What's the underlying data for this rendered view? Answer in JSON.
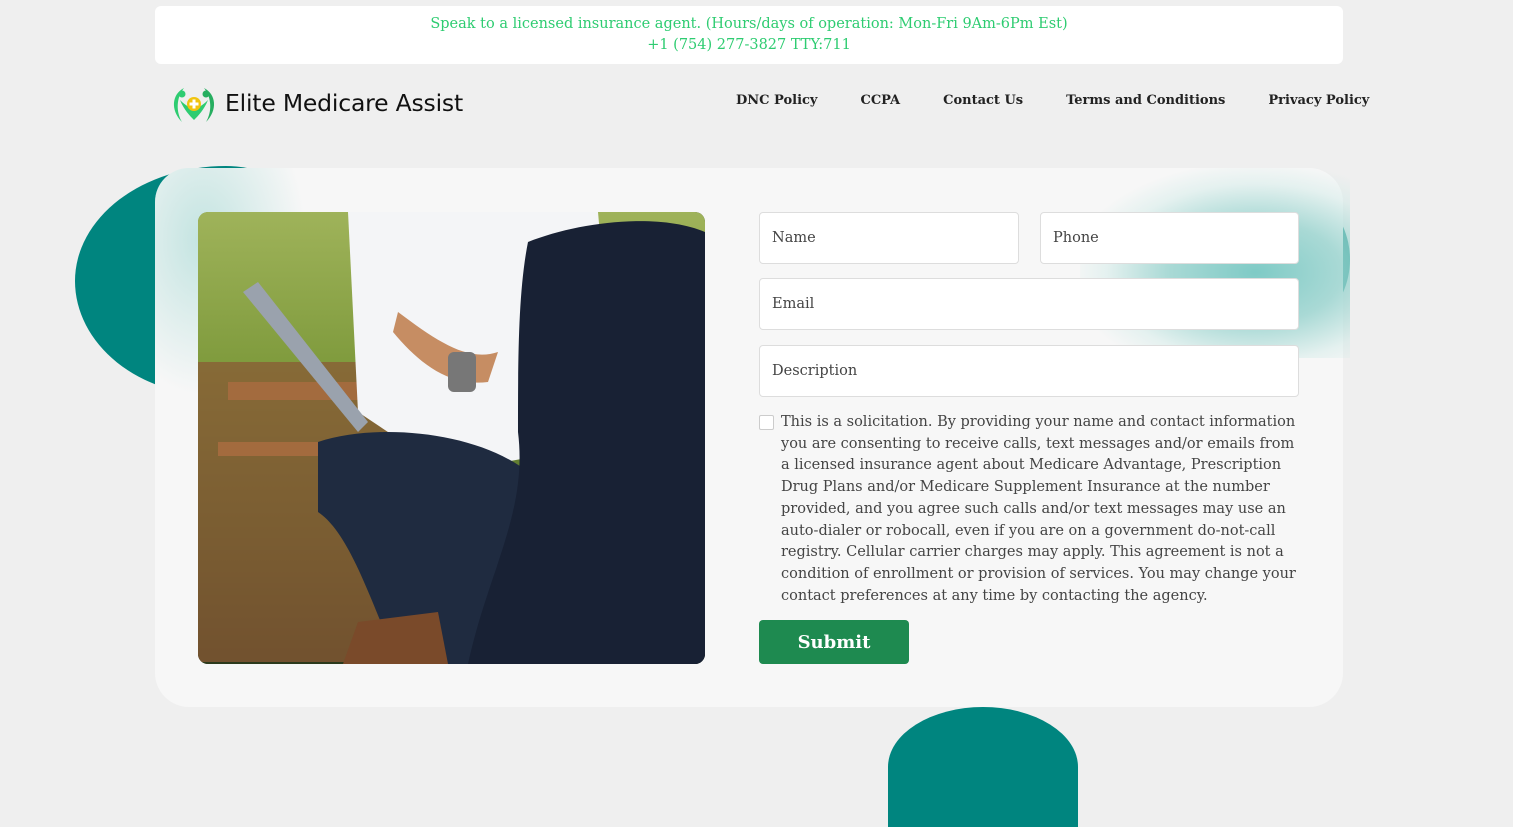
{
  "topbar": {
    "line1": "Speak to a licensed insurance agent. (Hours/days of operation: Mon-Fri 9Am-6Pm Est)",
    "line2": "+1 (754) 277-3827 TTY:711"
  },
  "brand": {
    "name": "Elite Medicare Assist",
    "icon": "medical-cross-people-icon"
  },
  "nav": {
    "dnc": "DNC Policy",
    "ccpa": "CCPA",
    "contact": "Contact Us",
    "terms": "Terms and Conditions",
    "privacy": "Privacy Policy"
  },
  "form": {
    "name_placeholder": "Name",
    "phone_placeholder": "Phone",
    "email_placeholder": "Email",
    "description_placeholder": "Description",
    "consent": "This is a solicitation. By providing your name and contact information you are consenting to receive calls, text messages and/or emails from a licensed insurance agent about Medicare Advantage, Prescription Drug Plans and/or Medicare Supplement Insurance at the number provided, and you agree such calls and/or text messages may use an auto-dialer or robocall, even if you are on a government do-not-call registry. Cellular carrier charges may apply. This agreement is not a condition of enrollment or provision of services. You may change your contact preferences at any time by contacting the agency.",
    "consent_checked": false,
    "submit_label": "Submit"
  },
  "colors": {
    "accent_green": "#2ecc71",
    "teal": "#00857f",
    "submit_bg": "#1e8a50"
  }
}
